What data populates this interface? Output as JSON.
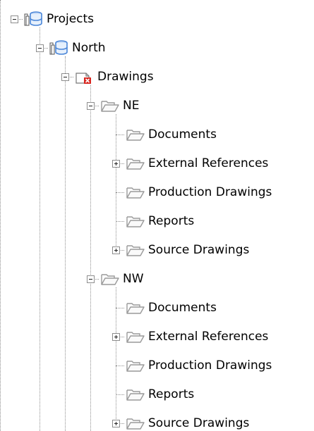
{
  "tree": {
    "nodes": [
      {
        "label": "Projects",
        "icon": "project-db-icon",
        "depth": 0,
        "expanded": true
      },
      {
        "label": "North",
        "icon": "project-db-icon",
        "depth": 1,
        "expanded": true
      },
      {
        "label": "Drawings",
        "icon": "drawings-category-icon",
        "depth": 2,
        "expanded": true
      },
      {
        "label": "NE",
        "icon": "folder-open-icon",
        "depth": 3,
        "expanded": true
      },
      {
        "label": "Documents",
        "icon": "folder-open-icon",
        "depth": 4,
        "expanded": null
      },
      {
        "label": "External References",
        "icon": "folder-open-icon",
        "depth": 4,
        "expanded": false
      },
      {
        "label": "Production Drawings",
        "icon": "folder-open-icon",
        "depth": 4,
        "expanded": null
      },
      {
        "label": "Reports",
        "icon": "folder-open-icon",
        "depth": 4,
        "expanded": null
      },
      {
        "label": "Source Drawings",
        "icon": "folder-open-icon",
        "depth": 4,
        "expanded": false
      },
      {
        "label": "NW",
        "icon": "folder-open-icon",
        "depth": 3,
        "expanded": true
      },
      {
        "label": "Documents",
        "icon": "folder-open-icon",
        "depth": 4,
        "expanded": null
      },
      {
        "label": "External References",
        "icon": "folder-open-icon",
        "depth": 4,
        "expanded": false
      },
      {
        "label": "Production Drawings",
        "icon": "folder-open-icon",
        "depth": 4,
        "expanded": null
      },
      {
        "label": "Reports",
        "icon": "folder-open-icon",
        "depth": 4,
        "expanded": null
      },
      {
        "label": "Source Drawings",
        "icon": "folder-open-icon",
        "depth": 4,
        "expanded": false
      }
    ]
  },
  "colors": {
    "tree_line": "#8f8f8f",
    "project_icon": "#4a86d8",
    "folder_icon": "#9a9a9a",
    "drawings_badge": "#d8261f"
  }
}
